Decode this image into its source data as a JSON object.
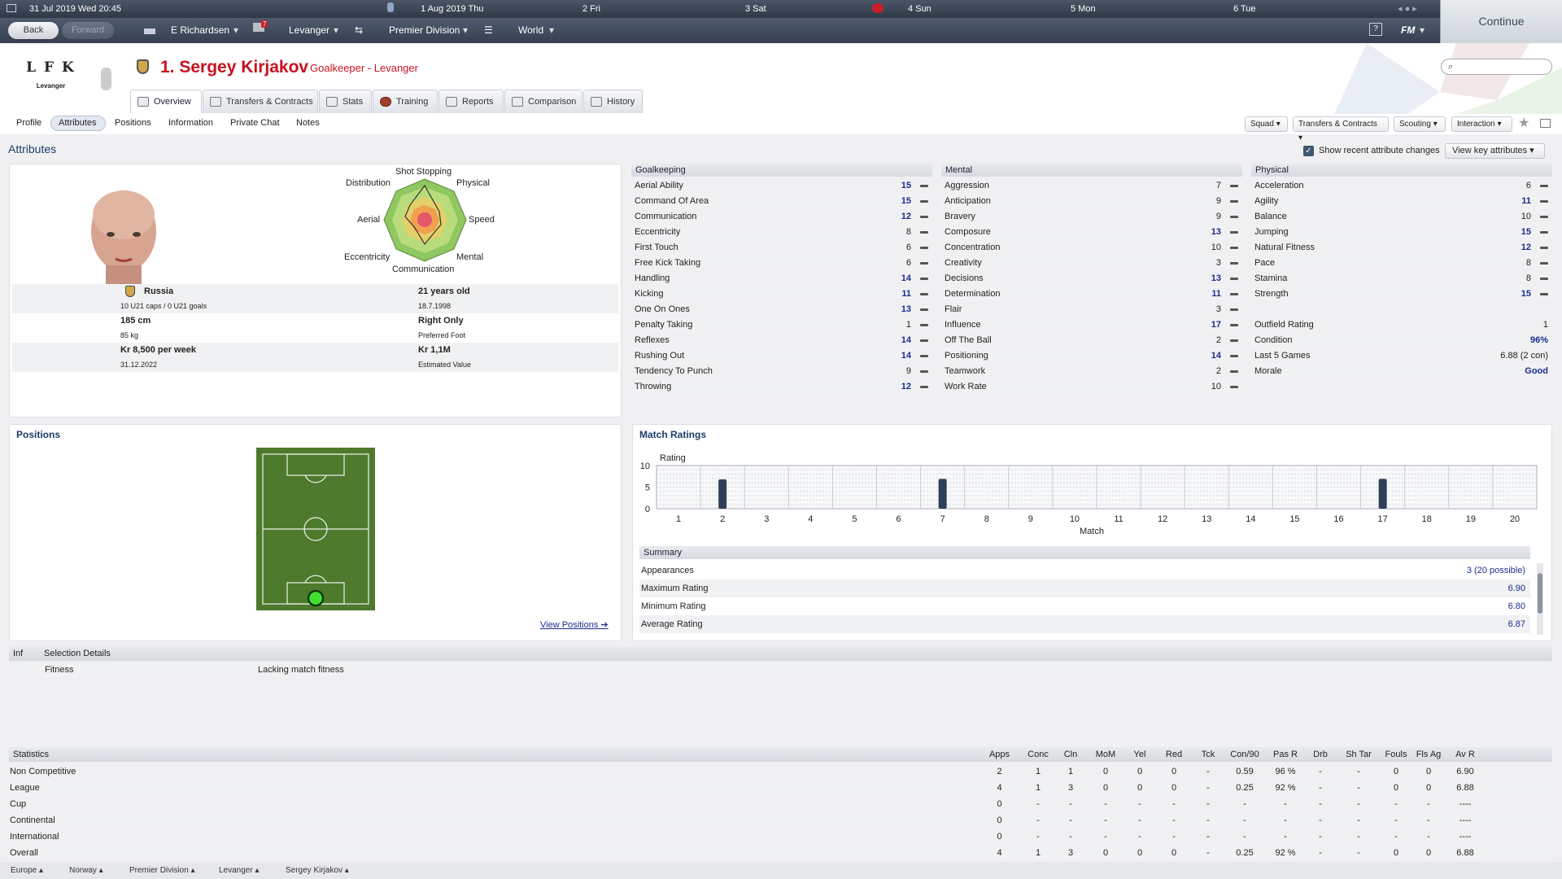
{
  "datebar": {
    "current": "31 Jul 2019  Wed 20:45",
    "days": [
      "1 Aug 2019  Thu",
      "2  Fri",
      "3  Sat",
      "4  Sun",
      "5  Mon",
      "6  Tue"
    ]
  },
  "navbar": {
    "back": "Back",
    "forward": "Forward",
    "manager": "E Richardsen",
    "club": "Levanger",
    "league": "Premier Division",
    "world": "World",
    "fm": "FM",
    "continue": "Continue",
    "badge_count": "7"
  },
  "club": {
    "logo_text": "L F K",
    "logo_sub": "Levanger"
  },
  "player": {
    "name": "1. Sergey Kirjakov",
    "role": "Goalkeeper - Levanger"
  },
  "tabs": [
    "Overview",
    "Transfers & Contracts",
    "Stats",
    "Training",
    "Reports",
    "Comparison",
    "History"
  ],
  "subnav": [
    "Profile",
    "Attributes",
    "Positions",
    "Information",
    "Private Chat",
    "Notes"
  ],
  "dropdowns": [
    "Squad",
    "Transfers & Contracts",
    "Scouting",
    "Interaction"
  ],
  "attributes_title": "Attributes",
  "show_recent": "Show recent attribute changes",
  "view_key": "View key attributes",
  "radar_labels": {
    "top": "Shot Stopping",
    "tr": "Physical",
    "r": "Speed",
    "br": "Mental",
    "b": "Communication",
    "bl": "Eccentricity",
    "l": "Aerial",
    "tl": "Distribution"
  },
  "info": {
    "nation": "Russia",
    "caps": "10 U21 caps / 0 U21 goals",
    "age": "21 years old",
    "dob": "18.7.1998",
    "height": "185 cm",
    "weight": "85 kg",
    "foot": "Right Only",
    "foot_label": "Preferred Foot",
    "wage": "Kr 8,500 per week",
    "contract": "31.12.2022",
    "value": "Kr 1,1M",
    "value_label": "Estimated Value"
  },
  "goalkeeping": {
    "title": "Goalkeeping",
    "rows": [
      [
        "Aerial Ability",
        "15"
      ],
      [
        "Command Of Area",
        "15"
      ],
      [
        "Communication",
        "12"
      ],
      [
        "Eccentricity",
        "8"
      ],
      [
        "First Touch",
        "6"
      ],
      [
        "Free Kick Taking",
        "6"
      ],
      [
        "Handling",
        "14"
      ],
      [
        "Kicking",
        "11"
      ],
      [
        "One On Ones",
        "13"
      ],
      [
        "Penalty Taking",
        "1"
      ],
      [
        "Reflexes",
        "14"
      ],
      [
        "Rushing Out",
        "14"
      ],
      [
        "Tendency To Punch",
        "9"
      ],
      [
        "Throwing",
        "12"
      ]
    ]
  },
  "mental": {
    "title": "Mental",
    "rows": [
      [
        "Aggression",
        "7"
      ],
      [
        "Anticipation",
        "9"
      ],
      [
        "Bravery",
        "9"
      ],
      [
        "Composure",
        "13"
      ],
      [
        "Concentration",
        "10"
      ],
      [
        "Creativity",
        "3"
      ],
      [
        "Decisions",
        "13"
      ],
      [
        "Determination",
        "11"
      ],
      [
        "Flair",
        "3"
      ],
      [
        "Influence",
        "17"
      ],
      [
        "Off The Ball",
        "2"
      ],
      [
        "Positioning",
        "14"
      ],
      [
        "Teamwork",
        "2"
      ],
      [
        "Work Rate",
        "10"
      ]
    ]
  },
  "physical": {
    "title": "Physical",
    "rows": [
      [
        "Acceleration",
        "6"
      ],
      [
        "Agility",
        "11"
      ],
      [
        "Balance",
        "10"
      ],
      [
        "Jumping",
        "15"
      ],
      [
        "Natural Fitness",
        "12"
      ],
      [
        "Pace",
        "8"
      ],
      [
        "Stamina",
        "8"
      ],
      [
        "Strength",
        "15"
      ]
    ],
    "extra": [
      [
        "Outfield Rating",
        "1"
      ],
      [
        "Condition",
        "96%"
      ],
      [
        "Last 5 Games",
        "6.88 (2 con)"
      ],
      [
        "Morale",
        "Good"
      ]
    ]
  },
  "positions": {
    "title": "Positions",
    "view": "View Positions"
  },
  "match_ratings": {
    "title": "Match Ratings"
  },
  "chart_data": {
    "type": "bar",
    "ylabel": "Rating",
    "xlabel": "Match",
    "ylim": [
      0,
      10
    ],
    "yticks": [
      "10",
      "5",
      "0"
    ],
    "categories": [
      "1",
      "2",
      "3",
      "4",
      "5",
      "6",
      "7",
      "8",
      "9",
      "10",
      "11",
      "12",
      "13",
      "14",
      "15",
      "16",
      "17",
      "18",
      "19",
      "20"
    ],
    "values": [
      null,
      6.8,
      null,
      null,
      null,
      null,
      6.9,
      null,
      null,
      null,
      null,
      null,
      null,
      null,
      null,
      null,
      6.9,
      null,
      null,
      null
    ]
  },
  "summary": {
    "title": "Summary",
    "rows": [
      [
        "Appearances",
        "3 (20 possible)"
      ],
      [
        "Maximum Rating",
        "6.90"
      ],
      [
        "Minimum Rating",
        "6.80"
      ],
      [
        "Average Rating",
        "6.87"
      ]
    ]
  },
  "selection": {
    "h1": "Inf",
    "h2": "Selection Details",
    "label": "Fitness",
    "value": "Lacking match fitness"
  },
  "stats": {
    "headers": [
      "Statistics",
      "Apps",
      "Conc",
      "Cln",
      "MoM",
      "Yel",
      "Red",
      "Tck",
      "Con/90",
      "Pas R",
      "Drb",
      "Sh Tar",
      "Fouls",
      "Fls Ag",
      "Av R"
    ],
    "rows": [
      [
        "Non Competitive",
        "2",
        "1",
        "1",
        "0",
        "0",
        "0",
        "-",
        "0.59",
        "96 %",
        "-",
        "-",
        "0",
        "0",
        "6.90"
      ],
      [
        "League",
        "4",
        "1",
        "3",
        "0",
        "0",
        "0",
        "-",
        "0.25",
        "92 %",
        "-",
        "-",
        "0",
        "0",
        "6.88"
      ],
      [
        "Cup",
        "0",
        "-",
        "-",
        "-",
        "-",
        "-",
        "-",
        "-",
        "-",
        "-",
        "-",
        "-",
        "-",
        "----"
      ],
      [
        "Continental",
        "0",
        "-",
        "-",
        "-",
        "-",
        "-",
        "-",
        "-",
        "-",
        "-",
        "-",
        "-",
        "-",
        "----"
      ],
      [
        "International",
        "0",
        "-",
        "-",
        "-",
        "-",
        "-",
        "-",
        "-",
        "-",
        "-",
        "-",
        "-",
        "-",
        "----"
      ],
      [
        "Overall",
        "4",
        "1",
        "3",
        "0",
        "0",
        "0",
        "-",
        "0.25",
        "92 %",
        "-",
        "-",
        "0",
        "0",
        "6.88"
      ]
    ]
  },
  "footer": [
    "Europe",
    "Norway",
    "Premier Division",
    "Levanger",
    "Sergey Kirjakov"
  ]
}
